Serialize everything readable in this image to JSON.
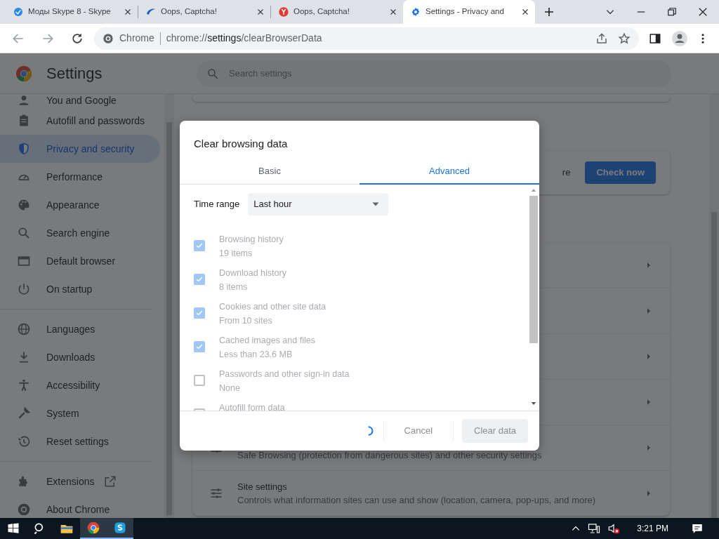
{
  "browser_tabs": [
    {
      "title": "Моды Skype 8 - Skype",
      "selected": false
    },
    {
      "title": "Oops, Captcha!",
      "selected": false
    },
    {
      "title": "Oops, Captcha!",
      "selected": false
    },
    {
      "title": "Settings - Privacy and",
      "selected": true
    }
  ],
  "address_bar": {
    "chip": "Chrome",
    "url_scheme": "chrome://",
    "url_host": "settings",
    "url_path": "/clearBrowserData"
  },
  "settings_header": {
    "title": "Settings",
    "search_placeholder": "Search settings"
  },
  "sidebar": {
    "sections": [
      {
        "items": [
          {
            "label": "You and Google",
            "selected": false
          },
          {
            "label": "Autofill and passwords",
            "selected": false
          },
          {
            "label": "Privacy and security",
            "selected": true
          },
          {
            "label": "Performance",
            "selected": false
          },
          {
            "label": "Appearance",
            "selected": false
          },
          {
            "label": "Search engine",
            "selected": false
          },
          {
            "label": "Default browser",
            "selected": false
          },
          {
            "label": "On startup",
            "selected": false
          }
        ]
      },
      {
        "items": [
          {
            "label": "Languages",
            "selected": false
          },
          {
            "label": "Downloads",
            "selected": false
          },
          {
            "label": "Accessibility",
            "selected": false
          },
          {
            "label": "System",
            "selected": false
          },
          {
            "label": "Reset settings",
            "selected": false
          }
        ]
      },
      {
        "items": [
          {
            "label": "Extensions",
            "selected": false,
            "external": true
          },
          {
            "label": "About Chrome",
            "selected": false
          }
        ]
      }
    ]
  },
  "safety_check": {
    "text": "re",
    "button": "Check now"
  },
  "privacy_rows": [
    {},
    {},
    {},
    {},
    {
      "subtitle": "Safe Browsing (protection from dangerous sites) and other security settings"
    },
    {
      "title": "Site settings",
      "subtitle": "Controls what information sites can use and show (location, camera, pop-ups, and more)"
    }
  ],
  "dialog": {
    "title": "Clear browsing data",
    "tabs": [
      {
        "label": "Basic",
        "selected": false
      },
      {
        "label": "Advanced",
        "selected": true
      }
    ],
    "time_range": {
      "label": "Time range",
      "value": "Last hour"
    },
    "items": [
      {
        "title": "Browsing history",
        "subtitle": "19 items",
        "checked": true,
        "disabled": true
      },
      {
        "title": "Download history",
        "subtitle": "8 items",
        "checked": true,
        "disabled": true
      },
      {
        "title": "Cookies and other site data",
        "subtitle": "From 10 sites",
        "checked": true,
        "disabled": true
      },
      {
        "title": "Cached images and files",
        "subtitle": "Less than 23.6 MB",
        "checked": true,
        "disabled": true
      },
      {
        "title": "Passwords and other sign-in data",
        "subtitle": "None",
        "checked": false,
        "disabled": true
      },
      {
        "title": "Autofill form data",
        "checked": false,
        "disabled": true
      }
    ],
    "buttons": [
      {
        "label": "Cancel",
        "disabled": true
      },
      {
        "label": "Clear data",
        "disabled": true
      }
    ]
  },
  "taskbar": {
    "clock": "3:21 PM"
  }
}
